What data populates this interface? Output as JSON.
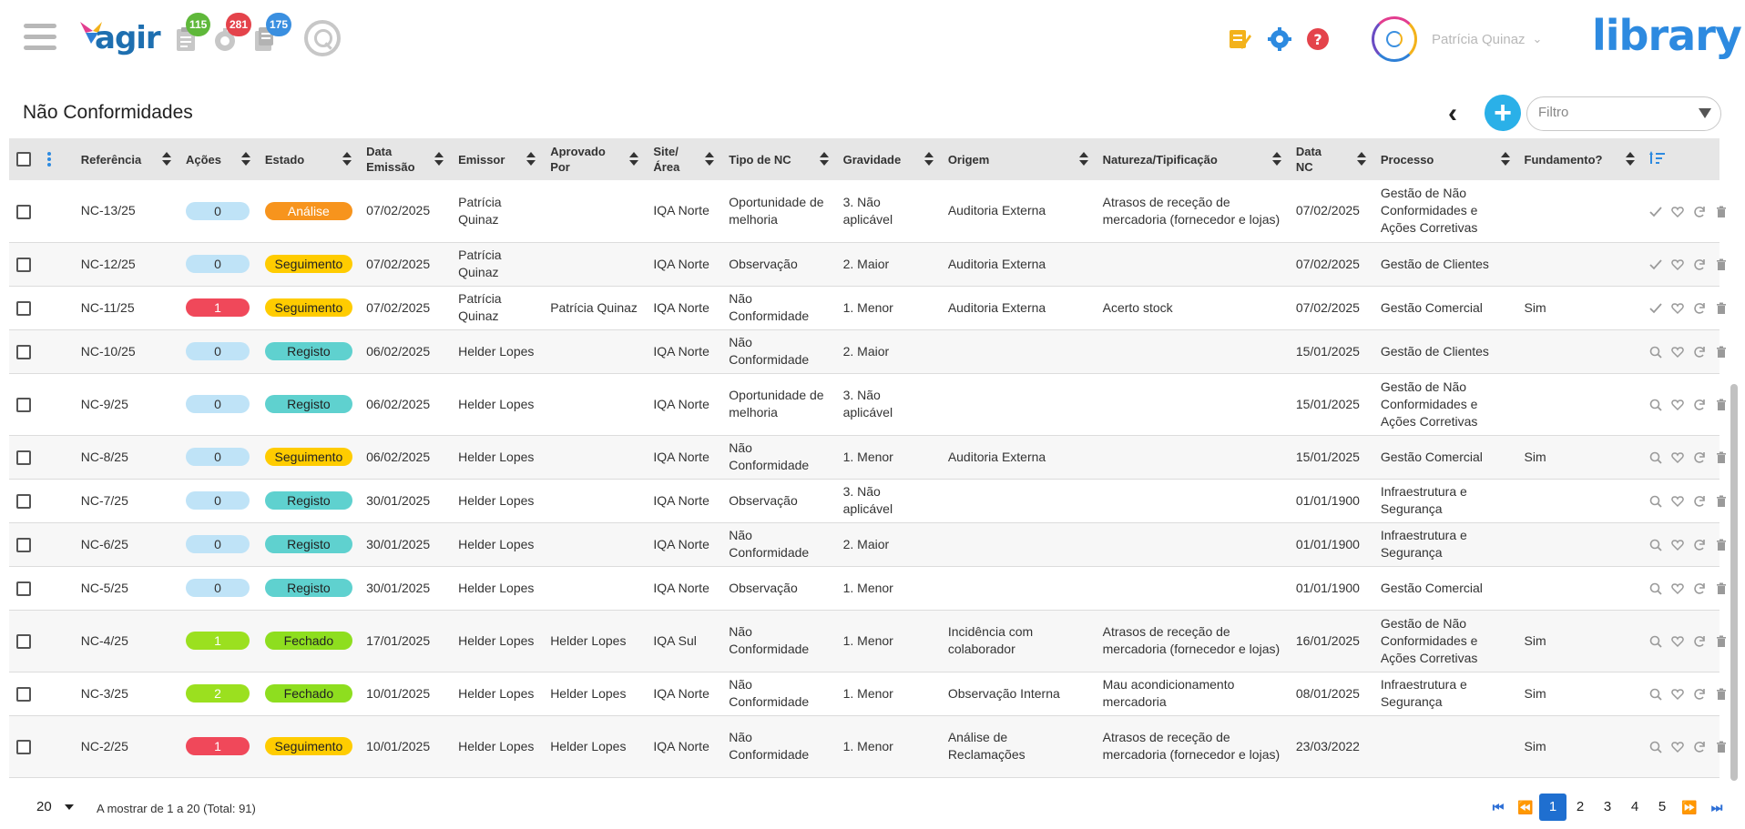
{
  "header": {
    "logo_text": "agir",
    "badges": [
      {
        "count": "115",
        "color": "green",
        "icon": "clipboard-icon"
      },
      {
        "count": "281",
        "color": "red",
        "icon": "gear-timer-icon"
      },
      {
        "count": "175",
        "color": "blue",
        "icon": "document-check-icon"
      }
    ],
    "user_name": "Patrícia Quinaz",
    "brand": "library",
    "icon_colors": {
      "notes": "#f3b21b",
      "settings": "#2d8ae0",
      "help": "#e4434b"
    }
  },
  "page": {
    "title": "Não Conformidades",
    "filter_placeholder": "Filtro"
  },
  "table": {
    "columns": [
      "Referência",
      "Ações",
      "Estado",
      "Data Emissão",
      "Emissor",
      "Aprovado Por",
      "Site/ Área",
      "Tipo de NC",
      "Gravidade",
      "Origem",
      "Natureza/Tipificação",
      "Data NC",
      "Processo",
      "Fundamento?"
    ],
    "rows": [
      {
        "ref": "NC-13/25",
        "acoes": "0",
        "acoes_color": "blue",
        "estado": "Análise",
        "estado_color": "orange",
        "data_emissao": "07/02/2025",
        "emissor": "Patrícia Quinaz",
        "aprovado": "",
        "site": "IQA Norte",
        "tipo": "Oportunidade de melhoria",
        "gravidade": "3. Não aplicável",
        "origem": "Auditoria Externa",
        "natureza": "Atrasos de receção de mercadoria (fornecedor e lojas)",
        "data_nc": "07/02/2025",
        "processo": "Gestão de Não Conformidades e Ações Corretivas",
        "fundamento": "",
        "first_action": "check"
      },
      {
        "ref": "NC-12/25",
        "acoes": "0",
        "acoes_color": "blue",
        "estado": "Seguimento",
        "estado_color": "yellow",
        "data_emissao": "07/02/2025",
        "emissor": "Patrícia Quinaz",
        "aprovado": "",
        "site": "IQA Norte",
        "tipo": "Observação",
        "gravidade": "2. Maior",
        "origem": "Auditoria Externa",
        "natureza": "",
        "data_nc": "07/02/2025",
        "processo": "Gestão de Clientes",
        "fundamento": "",
        "first_action": "check"
      },
      {
        "ref": "NC-11/25",
        "acoes": "1",
        "acoes_color": "red",
        "estado": "Seguimento",
        "estado_color": "yellow",
        "data_emissao": "07/02/2025",
        "emissor": "Patrícia Quinaz",
        "aprovado": "Patrícia Quinaz",
        "site": "IQA Norte",
        "tipo": "Não Conformidade",
        "gravidade": "1. Menor",
        "origem": "Auditoria Externa",
        "natureza": "Acerto stock",
        "data_nc": "07/02/2025",
        "processo": "Gestão Comercial",
        "fundamento": "Sim",
        "first_action": "check"
      },
      {
        "ref": "NC-10/25",
        "acoes": "0",
        "acoes_color": "blue",
        "estado": "Registo",
        "estado_color": "teal",
        "data_emissao": "06/02/2025",
        "emissor": "Helder Lopes",
        "aprovado": "",
        "site": "IQA Norte",
        "tipo": "Não Conformidade",
        "gravidade": "2. Maior",
        "origem": "",
        "natureza": "",
        "data_nc": "15/01/2025",
        "processo": "Gestão de Clientes",
        "fundamento": "",
        "first_action": "search"
      },
      {
        "ref": "NC-9/25",
        "acoes": "0",
        "acoes_color": "blue",
        "estado": "Registo",
        "estado_color": "teal",
        "data_emissao": "06/02/2025",
        "emissor": "Helder Lopes",
        "aprovado": "",
        "site": "IQA Norte",
        "tipo": "Oportunidade de melhoria",
        "gravidade": "3. Não aplicável",
        "origem": "",
        "natureza": "",
        "data_nc": "15/01/2025",
        "processo": "Gestão de Não Conformidades e Ações Corretivas",
        "fundamento": "",
        "first_action": "search"
      },
      {
        "ref": "NC-8/25",
        "acoes": "0",
        "acoes_color": "blue",
        "estado": "Seguimento",
        "estado_color": "yellow",
        "data_emissao": "06/02/2025",
        "emissor": "Helder Lopes",
        "aprovado": "",
        "site": "IQA Norte",
        "tipo": "Não Conformidade",
        "gravidade": "1. Menor",
        "origem": "Auditoria Externa",
        "natureza": "",
        "data_nc": "15/01/2025",
        "processo": "Gestão Comercial",
        "fundamento": "Sim",
        "first_action": "search"
      },
      {
        "ref": "NC-7/25",
        "acoes": "0",
        "acoes_color": "blue",
        "estado": "Registo",
        "estado_color": "teal",
        "data_emissao": "30/01/2025",
        "emissor": "Helder Lopes",
        "aprovado": "",
        "site": "IQA Norte",
        "tipo": "Observação",
        "gravidade": "3. Não aplicável",
        "origem": "",
        "natureza": "",
        "data_nc": "01/01/1900",
        "processo": "Infraestrutura e Segurança",
        "fundamento": "",
        "first_action": "search"
      },
      {
        "ref": "NC-6/25",
        "acoes": "0",
        "acoes_color": "blue",
        "estado": "Registo",
        "estado_color": "teal",
        "data_emissao": "30/01/2025",
        "emissor": "Helder Lopes",
        "aprovado": "",
        "site": "IQA Norte",
        "tipo": "Não Conformidade",
        "gravidade": "2. Maior",
        "origem": "",
        "natureza": "",
        "data_nc": "01/01/1900",
        "processo": "Infraestrutura e Segurança",
        "fundamento": "",
        "first_action": "search"
      },
      {
        "ref": "NC-5/25",
        "acoes": "0",
        "acoes_color": "blue",
        "estado": "Registo",
        "estado_color": "teal",
        "data_emissao": "30/01/2025",
        "emissor": "Helder Lopes",
        "aprovado": "",
        "site": "IQA Norte",
        "tipo": "Observação",
        "gravidade": "1. Menor",
        "origem": "",
        "natureza": "",
        "data_nc": "01/01/1900",
        "processo": "Gestão Comercial",
        "fundamento": "",
        "first_action": "search"
      },
      {
        "ref": "NC-4/25",
        "acoes": "1",
        "acoes_color": "green",
        "estado": "Fechado",
        "estado_color": "green",
        "data_emissao": "17/01/2025",
        "emissor": "Helder Lopes",
        "aprovado": "Helder Lopes",
        "site": "IQA Sul",
        "tipo": "Não Conformidade",
        "gravidade": "1. Menor",
        "origem": "Incidência com colaborador",
        "natureza": "Atrasos de receção de mercadoria (fornecedor e lojas)",
        "data_nc": "16/01/2025",
        "processo": "Gestão de Não Conformidades e Ações Corretivas",
        "fundamento": "Sim",
        "first_action": "search"
      },
      {
        "ref": "NC-3/25",
        "acoes": "2",
        "acoes_color": "green",
        "estado": "Fechado",
        "estado_color": "green",
        "data_emissao": "10/01/2025",
        "emissor": "Helder Lopes",
        "aprovado": "Helder Lopes",
        "site": "IQA Norte",
        "tipo": "Não Conformidade",
        "gravidade": "1. Menor",
        "origem": "Observação Interna",
        "natureza": "Mau acondicionamento mercadoria",
        "data_nc": "08/01/2025",
        "processo": "Infraestrutura e Segurança",
        "fundamento": "Sim",
        "first_action": "search"
      },
      {
        "ref": "NC-2/25",
        "acoes": "1",
        "acoes_color": "red",
        "estado": "Seguimento",
        "estado_color": "yellow",
        "data_emissao": "10/01/2025",
        "emissor": "Helder Lopes",
        "aprovado": "Helder Lopes",
        "site": "IQA Norte",
        "tipo": "Não Conformidade",
        "gravidade": "1. Menor",
        "origem": "Análise de Reclamações",
        "natureza": "Atrasos de receção de mercadoria (fornecedor e lojas)",
        "data_nc": "23/03/2022",
        "processo": "",
        "fundamento": "Sim",
        "first_action": "search"
      }
    ]
  },
  "colors": {
    "pill_blue": "#bfe3f7",
    "pill_red": "#f0485a",
    "pill_green": "#9be01f",
    "estado_orange": "#f7941d",
    "estado_yellow": "#ffcc00",
    "estado_teal": "#5fd1cf",
    "estado_green": "#8ede1f"
  },
  "footer": {
    "page_size": "20",
    "showing": "A mostrar de 1 a 20 (Total: 91)",
    "pages": [
      "1",
      "2",
      "3",
      "4",
      "5"
    ],
    "current_page": "1"
  }
}
